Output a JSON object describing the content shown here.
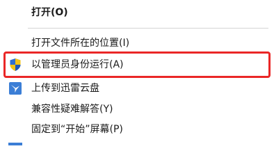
{
  "menu": {
    "open_label": "打开(O)",
    "open_location_label": "打开文件所在的位置(I)",
    "run_as_admin_label": "以管理员身份运行(A)",
    "upload_thunder_label": "上传到迅雷云盘",
    "compat_troubleshoot_label": "兼容性疑难解答(Y)",
    "pin_start_label": "固定到“开始”屏幕(P)"
  },
  "icons": {
    "run_as_admin": "uac-shield-icon",
    "upload_thunder": "thunder-cloud-icon"
  },
  "colors": {
    "highlight_border": "#ea2727",
    "shield_blue": "#2f6fd1",
    "shield_yellow": "#f3c316",
    "thunder_blue": "#3b7ed6"
  }
}
